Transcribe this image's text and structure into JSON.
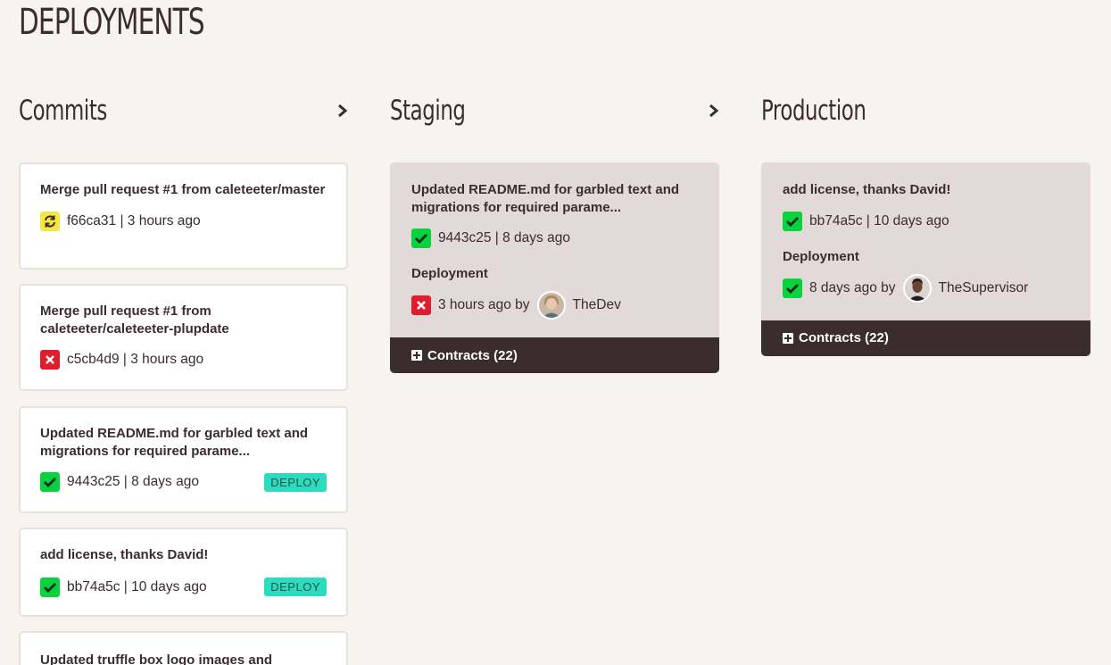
{
  "page": {
    "title": "DEPLOYMENTS"
  },
  "columns": {
    "commits": {
      "title": "Commits"
    },
    "staging": {
      "title": "Staging"
    },
    "production": {
      "title": "Production"
    }
  },
  "commits": [
    {
      "message": "Merge pull request #1 from caleteeter/master",
      "hash": "f66ca31",
      "time": "3 hours ago",
      "status": "pending",
      "deploy": ""
    },
    {
      "message": "Merge pull request #1 from caleteeter/caleteeter-plupdate",
      "hash": "c5cb4d9",
      "time": "3 hours ago",
      "status": "fail",
      "deploy": ""
    },
    {
      "message": "Updated README.md for garbled text and migrations for required parame...",
      "hash": "9443c25",
      "time": "8 days ago",
      "status": "ok",
      "deploy": "DEPLOY"
    },
    {
      "message": "add license, thanks David!",
      "hash": "bb74a5c",
      "time": "10 days ago",
      "status": "ok",
      "deploy": "DEPLOY"
    },
    {
      "message": "Updated truffle box logo images and",
      "hash": "",
      "time": "",
      "status": "",
      "deploy": ""
    }
  ],
  "staging": {
    "message": "Updated README.md for garbled text and migrations for required parame...",
    "commit_meta": "9443c25 | 8 days ago",
    "deployment_label": "Deployment",
    "deployment_time": "3 hours ago by",
    "deployment_user": "TheDev",
    "contracts_label": "Contracts (22)"
  },
  "production": {
    "message": "add license, thanks David!",
    "commit_meta": "bb74a5c | 10 days ago",
    "deployment_label": "Deployment",
    "deployment_time": "8 days ago by",
    "deployment_user": "TheSupervisor",
    "contracts_label": "Contracts (22)"
  },
  "commit_meta": {
    "c0": "f66ca31 | 3 hours ago",
    "c1": "c5cb4d9 | 3 hours ago",
    "c2": "9443c25 | 8 days ago",
    "c3": "bb74a5c | 10 days ago"
  },
  "icons": {
    "ok": "check-icon",
    "fail": "x-icon",
    "pending": "refresh-icon",
    "next": "chevron-right-icon",
    "expand": "plus-square-icon"
  },
  "colors": {
    "ok": "#06d33e",
    "fail": "#e01d2d",
    "pending": "#f4e641",
    "deploy": "#2ddcbf",
    "dark": "#3b2c2e"
  }
}
